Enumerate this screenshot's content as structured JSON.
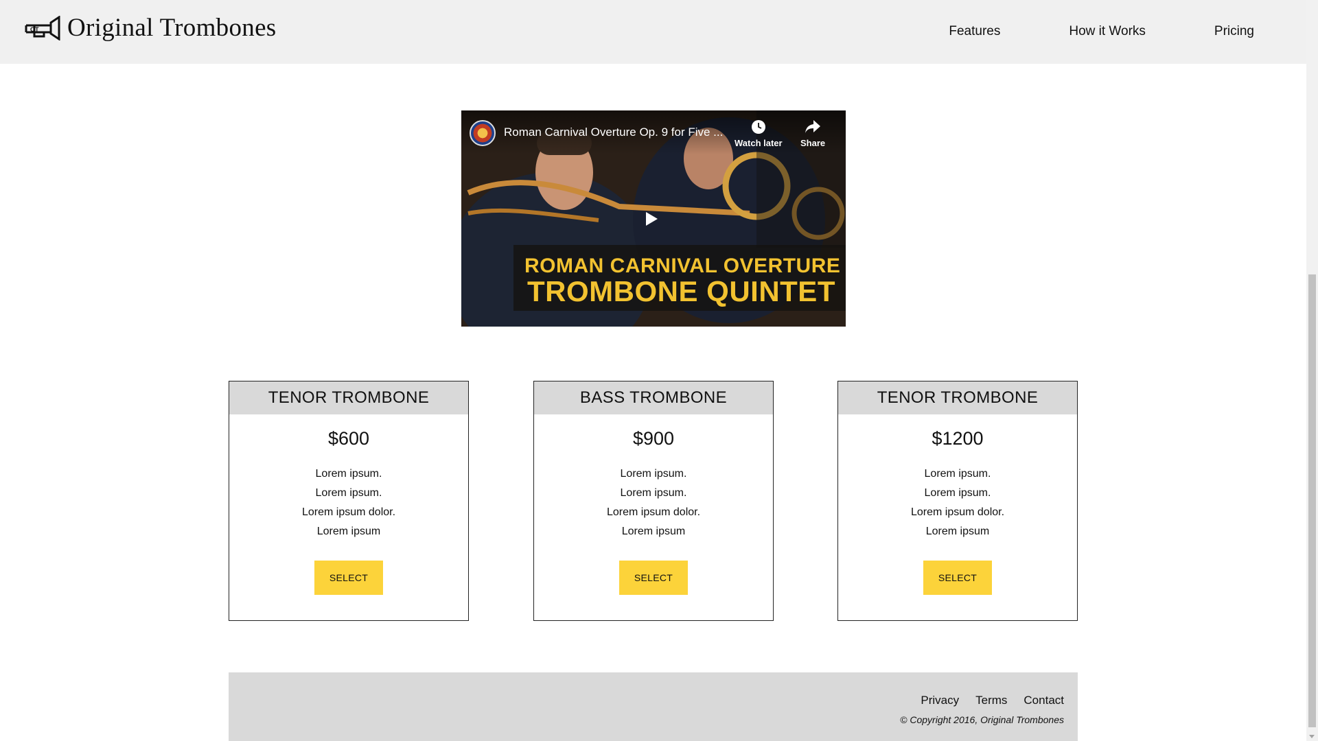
{
  "header": {
    "brand": "Original Trombones",
    "nav": [
      "Features",
      "How it Works",
      "Pricing"
    ]
  },
  "video": {
    "title": "Roman Carnival Overture Op. 9 for Five ...",
    "watch_later": "Watch later",
    "share": "Share",
    "banner_line1": "ROMAN CARNIVAL OVERTURE",
    "banner_line2": "TROMBONE QUINTET"
  },
  "pricing": [
    {
      "title": "TENOR TROMBONE",
      "price": "$600",
      "features": [
        "Lorem ipsum.",
        "Lorem ipsum.",
        "Lorem ipsum dolor.",
        "Lorem ipsum"
      ],
      "button": "SELECT"
    },
    {
      "title": "BASS TROMBONE",
      "price": "$900",
      "features": [
        "Lorem ipsum.",
        "Lorem ipsum.",
        "Lorem ipsum dolor.",
        "Lorem ipsum"
      ],
      "button": "SELECT"
    },
    {
      "title": "TENOR TROMBONE",
      "price": "$1200",
      "features": [
        "Lorem ipsum.",
        "Lorem ipsum.",
        "Lorem ipsum dolor.",
        "Lorem ipsum"
      ],
      "button": "SELECT"
    }
  ],
  "footer": {
    "links": [
      "Privacy",
      "Terms",
      "Contact"
    ],
    "copyright": "© Copyright 2016, Original Trombones"
  },
  "colors": {
    "accent": "#fcd33a",
    "header_bg": "#f0f0f0",
    "card_head_bg": "#d9d9d9",
    "footer_bg": "#d9d9d9",
    "banner_text": "#f2c230"
  },
  "icons": {
    "brand_logo": "trombone-icon",
    "watch_later": "clock-icon",
    "share": "share-arrow-icon",
    "play": "play-icon"
  }
}
